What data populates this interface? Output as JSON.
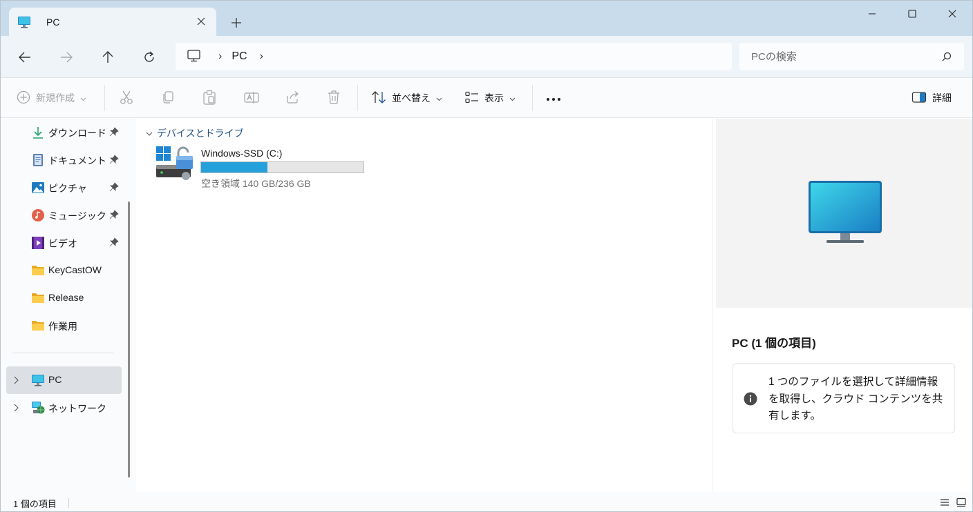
{
  "window": {
    "tab_title": "PC",
    "close_tab": "×",
    "new_tab": "+"
  },
  "address": {
    "crumbs": [
      "PC"
    ],
    "search_placeholder": "PCの検索"
  },
  "toolbar": {
    "new_label": "新規作成",
    "sort_label": "並べ替え",
    "view_label": "表示",
    "more_label": "•••",
    "details_label": "詳細"
  },
  "sidebar": {
    "quick_access": [
      {
        "label": "ダウンロード",
        "icon": "download-icon",
        "pinned": true
      },
      {
        "label": "ドキュメント",
        "icon": "document-icon",
        "pinned": true
      },
      {
        "label": "ピクチャ",
        "icon": "pictures-icon",
        "pinned": true
      },
      {
        "label": "ミュージック",
        "icon": "music-icon",
        "pinned": true
      },
      {
        "label": "ビデオ",
        "icon": "video-icon",
        "pinned": true
      },
      {
        "label": "KeyCastOW",
        "icon": "folder-icon",
        "pinned": false
      },
      {
        "label": "Release",
        "icon": "folder-icon",
        "pinned": false
      },
      {
        "label": "作業用",
        "icon": "folder-icon",
        "pinned": false
      }
    ],
    "locations": [
      {
        "label": "PC",
        "icon": "monitor-icon",
        "selected": true
      },
      {
        "label": "ネットワーク",
        "icon": "network-icon",
        "selected": false
      }
    ]
  },
  "content": {
    "group_label": "デバイスとドライブ",
    "drives": [
      {
        "name": "Windows-SSD (C:)",
        "free_text": "空き領域 140 GB/236 GB",
        "used_fraction": 0.407,
        "bar_color": "#26a0da"
      }
    ]
  },
  "details": {
    "title": "PC (1 個の項目)",
    "info": "1 つのファイルを選択して詳細情報を取得し、クラウド コンテンツを共有します。"
  },
  "status": {
    "item_count": "1 個の項目"
  },
  "colors": {
    "titlebar": "#c9dcec",
    "accent": "#26a0da",
    "group_header": "#1f4f85"
  }
}
